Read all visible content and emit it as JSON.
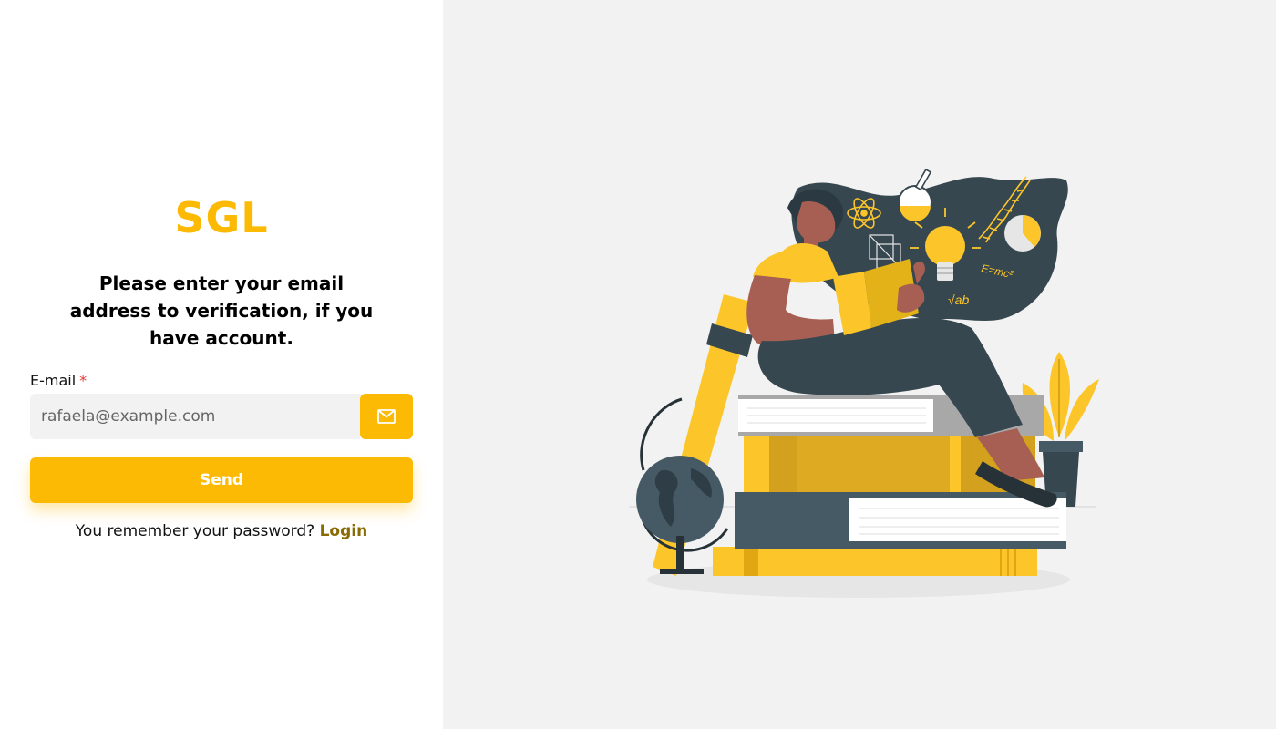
{
  "brand": {
    "logo": "SGL"
  },
  "form": {
    "heading": "Please enter your email address to verification, if you have account.",
    "email_label": "E-mail",
    "required_mark": "*",
    "email_placeholder": "rafaela@example.com",
    "mail_icon": "envelope-icon",
    "send_label": "Send"
  },
  "footer": {
    "remember_text": "You remember your password?",
    "login_label": "Login"
  },
  "illustration": {
    "subject": "woman-reading-on-books-icon",
    "formula_text": "E=mc²",
    "root_text": "√ab"
  },
  "colors": {
    "accent": "#fcba05",
    "link": "#8a6a05",
    "panel_bg": "#f2f2f2",
    "dark": "#37474f"
  }
}
